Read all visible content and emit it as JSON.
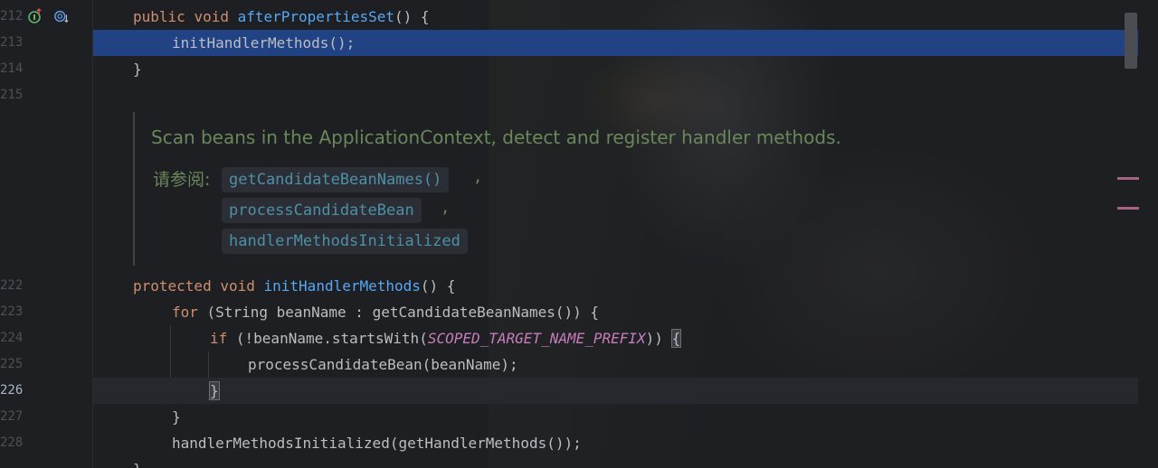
{
  "gutter": {
    "line_numbers": [
      "212",
      "213",
      "214",
      "215",
      "222",
      "223",
      "224",
      "225",
      "226",
      "227",
      "228"
    ],
    "active_line": "226"
  },
  "code": {
    "l212": {
      "kw1": "public",
      "kw2": "void",
      "fn": "afterPropertiesSet",
      "rest": "() {"
    },
    "l213": {
      "text": "initHandlerMethods();"
    },
    "l214": {
      "text": "}"
    },
    "l222": {
      "kw1": "protected",
      "kw2": "void",
      "fn": "initHandlerMethods",
      "rest": "() {"
    },
    "l223": {
      "kw": "for",
      "rest": " (String beanName : getCandidateBeanNames()) {"
    },
    "l224": {
      "kw": "if",
      "pre": " (!beanName.startsWith(",
      "const": "SCOPED_TARGET_NAME_PREFIX",
      "post": ")) ",
      "brace": "{"
    },
    "l225": {
      "text": "processCandidateBean(beanName);"
    },
    "l226": {
      "brace": "}"
    },
    "l227": {
      "text": "}"
    },
    "l228": {
      "text": "handlerMethodsInitialized(getHandlerMethods());"
    },
    "l229": {
      "text": "}"
    }
  },
  "doc": {
    "summary": "Scan beans in the ApplicationContext, detect and register handler methods.",
    "see_label": "请参阅:",
    "links": [
      "getCandidateBeanNames()",
      "processCandidateBean",
      "handlerMethodsInitialized"
    ],
    "separator": ","
  },
  "icons": [
    "implementation-icon",
    "override-icon"
  ],
  "colors": {
    "background": "#1e1f22",
    "selection": "#214283",
    "keyword": "#cf8e6d",
    "function": "#56a8f5",
    "constant": "#c77dbb",
    "doc_text": "#6a8759",
    "doc_link": "#4e8fa8"
  }
}
